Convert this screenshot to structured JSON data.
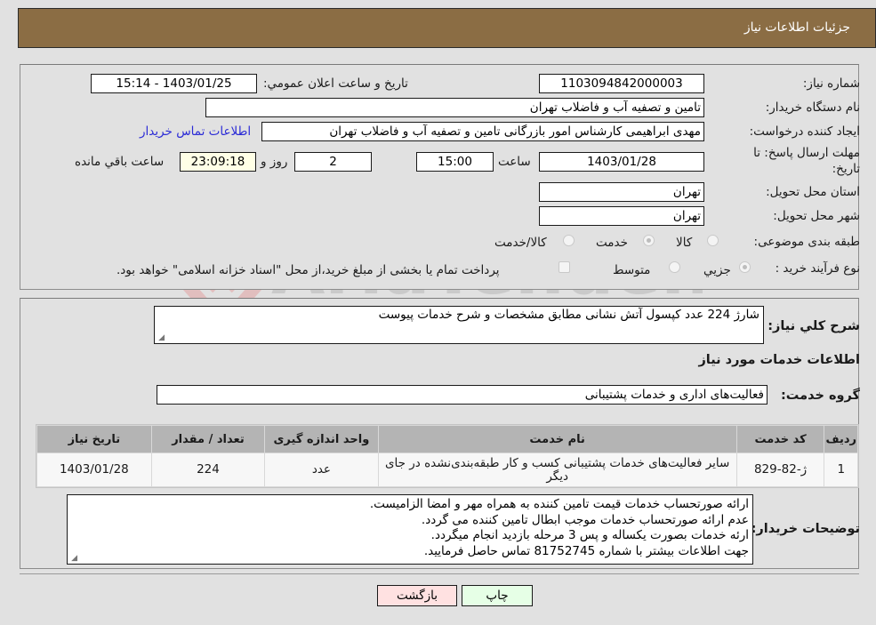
{
  "header": {
    "title": "جزئيات اطلاعات نياز"
  },
  "fields": {
    "need_number": {
      "label": "شماره نياز:",
      "value": "1103094842000003"
    },
    "announce_datetime": {
      "label": "تاريخ و ساعت اعلان عمومي:",
      "value": "1403/01/25 - 15:14"
    },
    "buyer_org": {
      "label": "نام دستگاه خريدار:",
      "value": "تامين و تصفيه آب و فاضلاب تهران"
    },
    "requester": {
      "label": "ايجاد کننده درخواست:",
      "value": "مهدی ابراهیمی کارشناس امور بازرگانی تامين و تصفيه آب و فاضلاب تهران",
      "contact_link": "اطلاعات تماس خريدار"
    },
    "deadline": {
      "label": "مهلت ارسال پاسخ: تا تاريخ:",
      "date": "1403/01/28",
      "time_label": "ساعت",
      "time": "15:00",
      "days": "2",
      "days_label": "روز و",
      "remaining": "23:09:18",
      "remaining_label": "ساعت باقي مانده"
    },
    "province": {
      "label": "استان محل تحويل:",
      "value": "تهران"
    },
    "city": {
      "label": "شهر محل تحويل:",
      "value": "تهران"
    },
    "category": {
      "label": "طبقه بندی موضوعی:",
      "options": [
        {
          "label": "کالا",
          "checked": false
        },
        {
          "label": "خدمت",
          "checked": true
        },
        {
          "label": "کالا/خدمت",
          "checked": false
        }
      ]
    },
    "purchase_type": {
      "label": "نوع فرآيند خريد :",
      "options": [
        {
          "label": "جزيي",
          "checked": true
        },
        {
          "label": "متوسط",
          "checked": false
        }
      ],
      "treasury_note": "پرداخت تمام يا بخشی از مبلغ خريد،از محل \"اسناد خزانه اسلامی\" خواهد بود."
    }
  },
  "description": {
    "label": "شرح کلي نياز:",
    "value": "شارژ 224 عدد کپسول آتش نشانی مطابق مشخصات و شرح خدمات پيوست"
  },
  "services_section": {
    "title": "اطلاعات خدمات مورد نياز",
    "group_label": "گروه خدمت:",
    "group_value": "فعاليت‌های اداری و خدمات پشتيبانی",
    "table": {
      "headers": [
        "رديف",
        "کد خدمت",
        "نام خدمت",
        "واحد اندازه گيری",
        "تعداد / مقدار",
        "تاريخ نياز"
      ],
      "rows": [
        {
          "index": "1",
          "code": "ژ-82-829",
          "name": "ساير فعاليت‌های خدمات پشتيبانی کسب و کار طبقه‌بندی‌نشده در جای ديگر",
          "unit": "عدد",
          "quantity": "224",
          "date": "1403/01/28"
        }
      ]
    }
  },
  "buyer_notes": {
    "label": "توضيحات خريدار:",
    "lines": [
      "ارائه صورتحساب خدمات قيمت تامين کننده به همراه مهر و امضا الزاميست.",
      "عدم ارائه صورتحساب خدمات موجب ابطال تامين کننده می گردد.",
      "ارئه خدمات بصورت يکساله و پس 3 مرحله بازديد انجام ميگردد.",
      "جهت اطلاعات بيشتر با شماره 81752745 تماس حاصل فرماييد."
    ]
  },
  "buttons": {
    "print": "چاپ",
    "back": "بازگشت"
  },
  "watermark": {
    "text": "AriaTender.neT"
  },
  "colors": {
    "header_bg": "#8b6d44",
    "link": "#2b2bd6",
    "back_btn": "#ffe1e1",
    "print_btn": "#e6ffe6",
    "remaining_bg": "#ffffe6"
  }
}
